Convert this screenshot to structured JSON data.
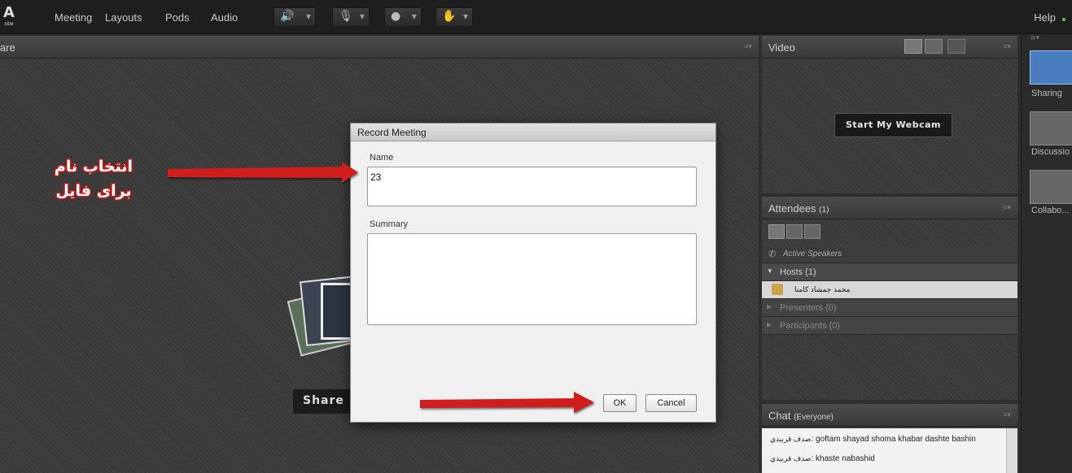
{
  "menubar": {
    "logo": "A",
    "logo_sub": "obe",
    "items": [
      "Meeting",
      "Layouts",
      "Pods",
      "Audio"
    ],
    "help": "Help"
  },
  "share_pod": {
    "title": "are",
    "share_button": "Share M"
  },
  "video_pod": {
    "title": "Video",
    "webcam_button": "Start My Webcam"
  },
  "attendees_pod": {
    "title": "Attendees",
    "count": "(1)",
    "active_speakers": "Active Speakers",
    "hosts": "Hosts (1)",
    "host_name": "محمد جمشاد کامنا",
    "presenters": "Presenters (0)",
    "participants": "Participants (0)"
  },
  "chat_pod": {
    "title": "Chat",
    "scope": "(Everyone)",
    "messages": [
      {
        "sender": "صدف قربيدي",
        "text": "goftam shayad shoma khabar dashte bashin"
      },
      {
        "sender": "صدف قربيدي",
        "text": "khaste nabashid"
      }
    ]
  },
  "layouts": {
    "items": [
      "Sharing",
      "Discussio",
      "Collabo..."
    ]
  },
  "dialog": {
    "title": "Record Meeting",
    "name_label": "Name",
    "name_value": "23",
    "summary_label": "Summary",
    "summary_value": "",
    "ok": "OK",
    "cancel": "Cancel"
  },
  "annotation": {
    "line1": "انتخاب نام",
    "line2": "برای فایل",
    "color": "#d01e1e"
  }
}
